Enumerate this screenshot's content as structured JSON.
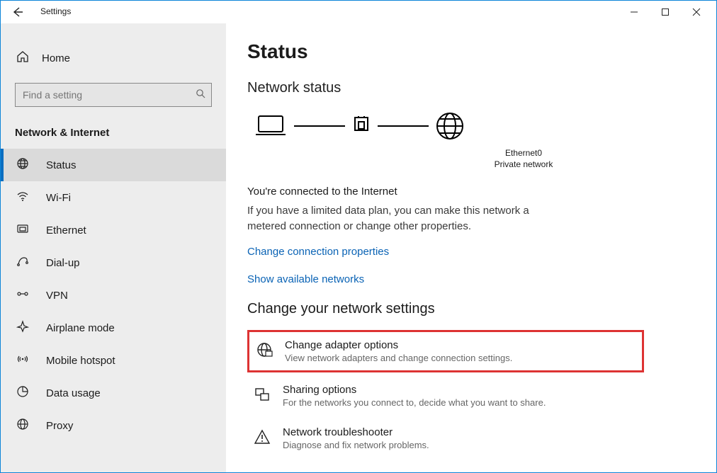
{
  "window": {
    "title": "Settings"
  },
  "sidebar": {
    "home_label": "Home",
    "search_placeholder": "Find a setting",
    "heading": "Network & Internet",
    "items": [
      {
        "label": "Status"
      },
      {
        "label": "Wi-Fi"
      },
      {
        "label": "Ethernet"
      },
      {
        "label": "Dial-up"
      },
      {
        "label": "VPN"
      },
      {
        "label": "Airplane mode"
      },
      {
        "label": "Mobile hotspot"
      },
      {
        "label": "Data usage"
      },
      {
        "label": "Proxy"
      }
    ]
  },
  "main": {
    "page_title": "Status",
    "network_status_heading": "Network status",
    "diag": {
      "adapter_name": "Ethernet0",
      "network_type": "Private network"
    },
    "connected_title": "You're connected to the Internet",
    "connected_text": "If you have a limited data plan, you can make this network a metered connection or change other properties.",
    "link_change": "Change connection properties",
    "link_show": "Show available networks",
    "change_settings_heading": "Change your network settings",
    "rows": [
      {
        "title": "Change adapter options",
        "desc": "View network adapters and change connection settings."
      },
      {
        "title": "Sharing options",
        "desc": "For the networks you connect to, decide what you want to share."
      },
      {
        "title": "Network troubleshooter",
        "desc": "Diagnose and fix network problems."
      }
    ]
  }
}
